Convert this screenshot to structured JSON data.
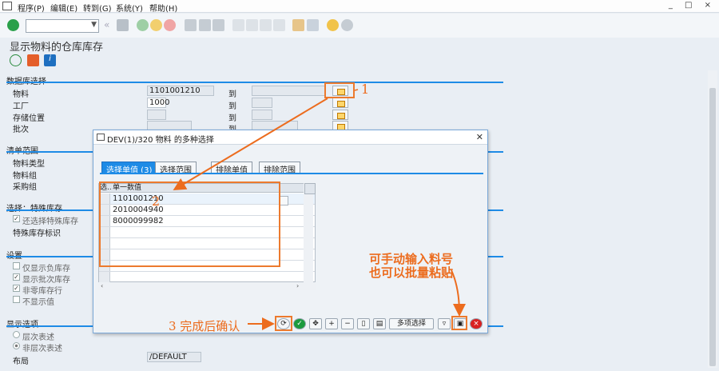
{
  "menu": {
    "items": [
      "程序(P)",
      "编辑(E)",
      "转到(G)",
      "系统(Y)",
      "帮助(H)"
    ]
  },
  "window_controls": "_ □ ×",
  "page_title": "显示物料的仓库库存",
  "sections": {
    "db_selection": {
      "title": "数据库选择",
      "to_label": "到",
      "rows": [
        {
          "label": "物料",
          "value": "1101001210"
        },
        {
          "label": "工厂",
          "value": "1000"
        },
        {
          "label": "存储位置",
          "value": ""
        },
        {
          "label": "批次",
          "value": ""
        }
      ]
    },
    "list_scope": {
      "title": "清单范围",
      "rows": [
        "物料类型",
        "物料组",
        "采购组"
      ]
    },
    "special_stock": {
      "title": "选择：特殊库存",
      "items": [
        "还选择特殊库存",
        "特殊库存标识"
      ]
    },
    "settings": {
      "title": "设置",
      "items": [
        "仅显示负库存",
        "显示批次库存",
        "非零库存行",
        "不显示值"
      ]
    },
    "display": {
      "title": "显示选项",
      "items": [
        "层次表述",
        "非层次表述"
      ],
      "layout_label": "布局",
      "layout_value": "/DEFAULT"
    }
  },
  "dialog": {
    "title": "DEV(1)/320 物料 的多种选择",
    "tabs": [
      "选择单值 (3)",
      "选择范围",
      "排除单值",
      "排除范围"
    ],
    "grid": {
      "header_sel": "选..",
      "header_value": "单一数值",
      "values": [
        "1101001210",
        "2010004940",
        "8000099982"
      ]
    },
    "buttons": {
      "multi_select": "多项选择"
    }
  },
  "annotations": {
    "step1": "1",
    "step2": "2",
    "step3": "3 完成后确认",
    "note_line1": "可手动输入料号",
    "note_line2": "也可以批量粘贴"
  },
  "colors": {
    "accent": "#1e8be6",
    "annotation": "#ec6c1e",
    "confirm": "#1b9a3e",
    "cancel": "#d92020"
  }
}
